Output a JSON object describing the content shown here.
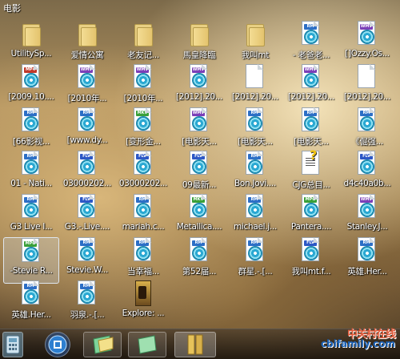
{
  "window": {
    "title": "电影"
  },
  "colors": {
    "mp4": "#c0392b",
    "rm": "#2d6fc6",
    "wmv": "#7b3fb8",
    "mkv": "#3aa03a",
    "flv": "#2d58c6",
    "mpg": "#3aa03a"
  },
  "rows": [
    [
      {
        "icon": "folder",
        "label": "UtilitySp..."
      },
      {
        "icon": "folder",
        "label": "爱情公寓"
      },
      {
        "icon": "folder",
        "label": "老友记..."
      },
      {
        "icon": "folder",
        "label": "馬皇降臨"
      },
      {
        "icon": "folder",
        "label": "我叫mt"
      },
      {
        "icon": "rm",
        "badge": "RM",
        "label": "- 老爸老..."
      },
      {
        "icon": "wmv",
        "badge": "WMV",
        "label": "[]Ozzy.Os..."
      }
    ],
    [
      {
        "icon": "mp4",
        "badge": "MP4",
        "label": "[2009.10...."
      },
      {
        "icon": "wmv",
        "badge": "WMV",
        "label": "[2010年..."
      },
      {
        "icon": "wmv",
        "badge": "WMV",
        "label": "[2010年..."
      },
      {
        "icon": "wmv",
        "badge": "WMV",
        "label": "[2012].20..."
      },
      {
        "icon": "blank",
        "label": "[2012].20..."
      },
      {
        "icon": "wmv",
        "badge": "WMV",
        "label": "[2012].20..."
      },
      {
        "icon": "blank",
        "label": "[2012].20..."
      }
    ],
    [
      {
        "icon": "rm",
        "badge": "RM",
        "label": "[66影视..."
      },
      {
        "icon": "rm",
        "badge": "RM",
        "label": "[www.dy..."
      },
      {
        "icon": "mkv",
        "badge": "MKV",
        "label": "[变形金..."
      },
      {
        "icon": "wmv",
        "badge": "WMV",
        "label": "[电影天..."
      },
      {
        "icon": "rm",
        "badge": "RM",
        "label": "[电影天..."
      },
      {
        "icon": "rm",
        "badge": "RM",
        "label": "[电影天..."
      },
      {
        "icon": "rm",
        "badge": "RM",
        "label": "《倔强..."
      }
    ],
    [
      {
        "icon": "rm",
        "badge": "RM",
        "label": "01 - Nati..."
      },
      {
        "icon": "flv",
        "badge": "FLV",
        "label": "03000202..."
      },
      {
        "icon": "flv",
        "badge": "FLV",
        "label": "03000202..."
      },
      {
        "icon": "flv",
        "badge": "FLV",
        "label": "09最新..."
      },
      {
        "icon": "rm",
        "badge": "RM",
        "label": "Bon.Jovi...."
      },
      {
        "icon": "note",
        "label": "CJG总目..."
      },
      {
        "icon": "flv",
        "badge": "FLV",
        "label": "d4c40a0b..."
      }
    ],
    [
      {
        "icon": "rm",
        "badge": "RM",
        "label": "G3 Live I..."
      },
      {
        "icon": "flv",
        "badge": "FLV",
        "label": "G3.-.Live...."
      },
      {
        "icon": "rm",
        "badge": "RM",
        "label": "mariah.c..."
      },
      {
        "icon": "mkv",
        "badge": "MKV",
        "label": "Metallica...."
      },
      {
        "icon": "rm",
        "badge": "RM",
        "label": "michael.j..."
      },
      {
        "icon": "mpg",
        "badge": "MPG",
        "label": "Pantera...."
      },
      {
        "icon": "wmv",
        "badge": "WMV",
        "label": "Stanley.J..."
      }
    ],
    [
      {
        "icon": "mpg",
        "badge": "MPG",
        "label": "-Stevie R...",
        "selected": true
      },
      {
        "icon": "rm",
        "badge": "RM",
        "label": "Stevie.W..."
      },
      {
        "icon": "rm",
        "badge": "RM",
        "label": "当幸福..."
      },
      {
        "icon": "rm",
        "badge": "RM",
        "label": "第52届..."
      },
      {
        "icon": "rm",
        "badge": "RM",
        "label": "群星.-.[..."
      },
      {
        "icon": "flv",
        "badge": "FLV",
        "label": "我叫mt.f..."
      },
      {
        "icon": "rm",
        "badge": "RM",
        "label": "英雄.Her..."
      }
    ],
    [
      {
        "icon": "rm",
        "badge": "RM",
        "label": "英雄.Her..."
      },
      {
        "icon": "rm",
        "badge": "RM",
        "label": "羽泉.-.[..."
      },
      {
        "icon": "movie",
        "label": "Explore: ..."
      }
    ]
  ],
  "taskbar": {
    "items": [
      "calculator",
      "ie",
      "explorer-1",
      "explorer-2",
      "explorer-3"
    ]
  },
  "watermark": {
    "cn": "中关村在线",
    "en": "cbifamily.com"
  }
}
